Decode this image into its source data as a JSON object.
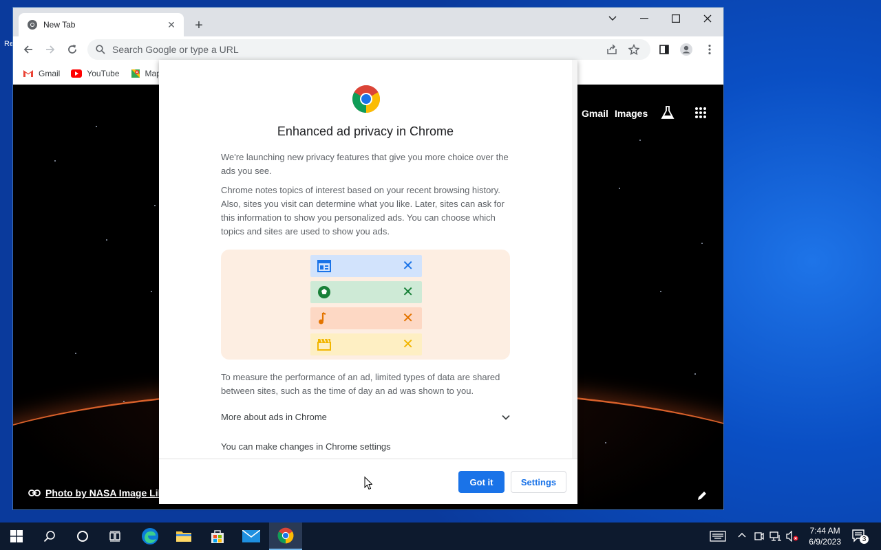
{
  "desktop": {
    "frag_text": "Re"
  },
  "browser": {
    "tab_title": "New Tab",
    "omnibox_placeholder": "Search Google or type a URL",
    "bookmarks": [
      {
        "label": "Gmail",
        "icon": "gmail-icon"
      },
      {
        "label": "YouTube",
        "icon": "youtube-icon"
      },
      {
        "label": "Maps",
        "icon": "maps-icon"
      }
    ]
  },
  "ntp": {
    "gmail_link": "Gmail",
    "images_link": "Images",
    "photo_credit": "Photo by NASA Image Library"
  },
  "dialog": {
    "title": "Enhanced ad privacy in Chrome",
    "para1": "We're launching new privacy features that give you more choice over the ads you see.",
    "para2": "Chrome notes topics of interest based on your recent browsing history. Also, sites you visit can determine what you like. Later, sites can ask for this information to show you personalized ads. You can choose which topics and sites are used to show you ads.",
    "para3": "To measure the performance of an ad, limited types of data are shared between sites, such as the time of day an ad was shown to you.",
    "expander_label": "More about ads in Chrome",
    "settings_note": "You can make changes in Chrome settings",
    "got_it": "Got it",
    "settings": "Settings",
    "chips": [
      {
        "icon": "news-icon",
        "color": "#1a73e8",
        "bg": "#d2e3fc"
      },
      {
        "icon": "soccer-icon",
        "color": "#188038",
        "bg": "#ceead6"
      },
      {
        "icon": "music-note-icon",
        "color": "#e37400",
        "bg": "#fdd8c4"
      },
      {
        "icon": "clapperboard-icon",
        "color": "#f2b600",
        "bg": "#feefc3"
      }
    ]
  },
  "taskbar": {
    "time": "7:44 AM",
    "date": "6/9/2023",
    "notifications_count": "3"
  }
}
